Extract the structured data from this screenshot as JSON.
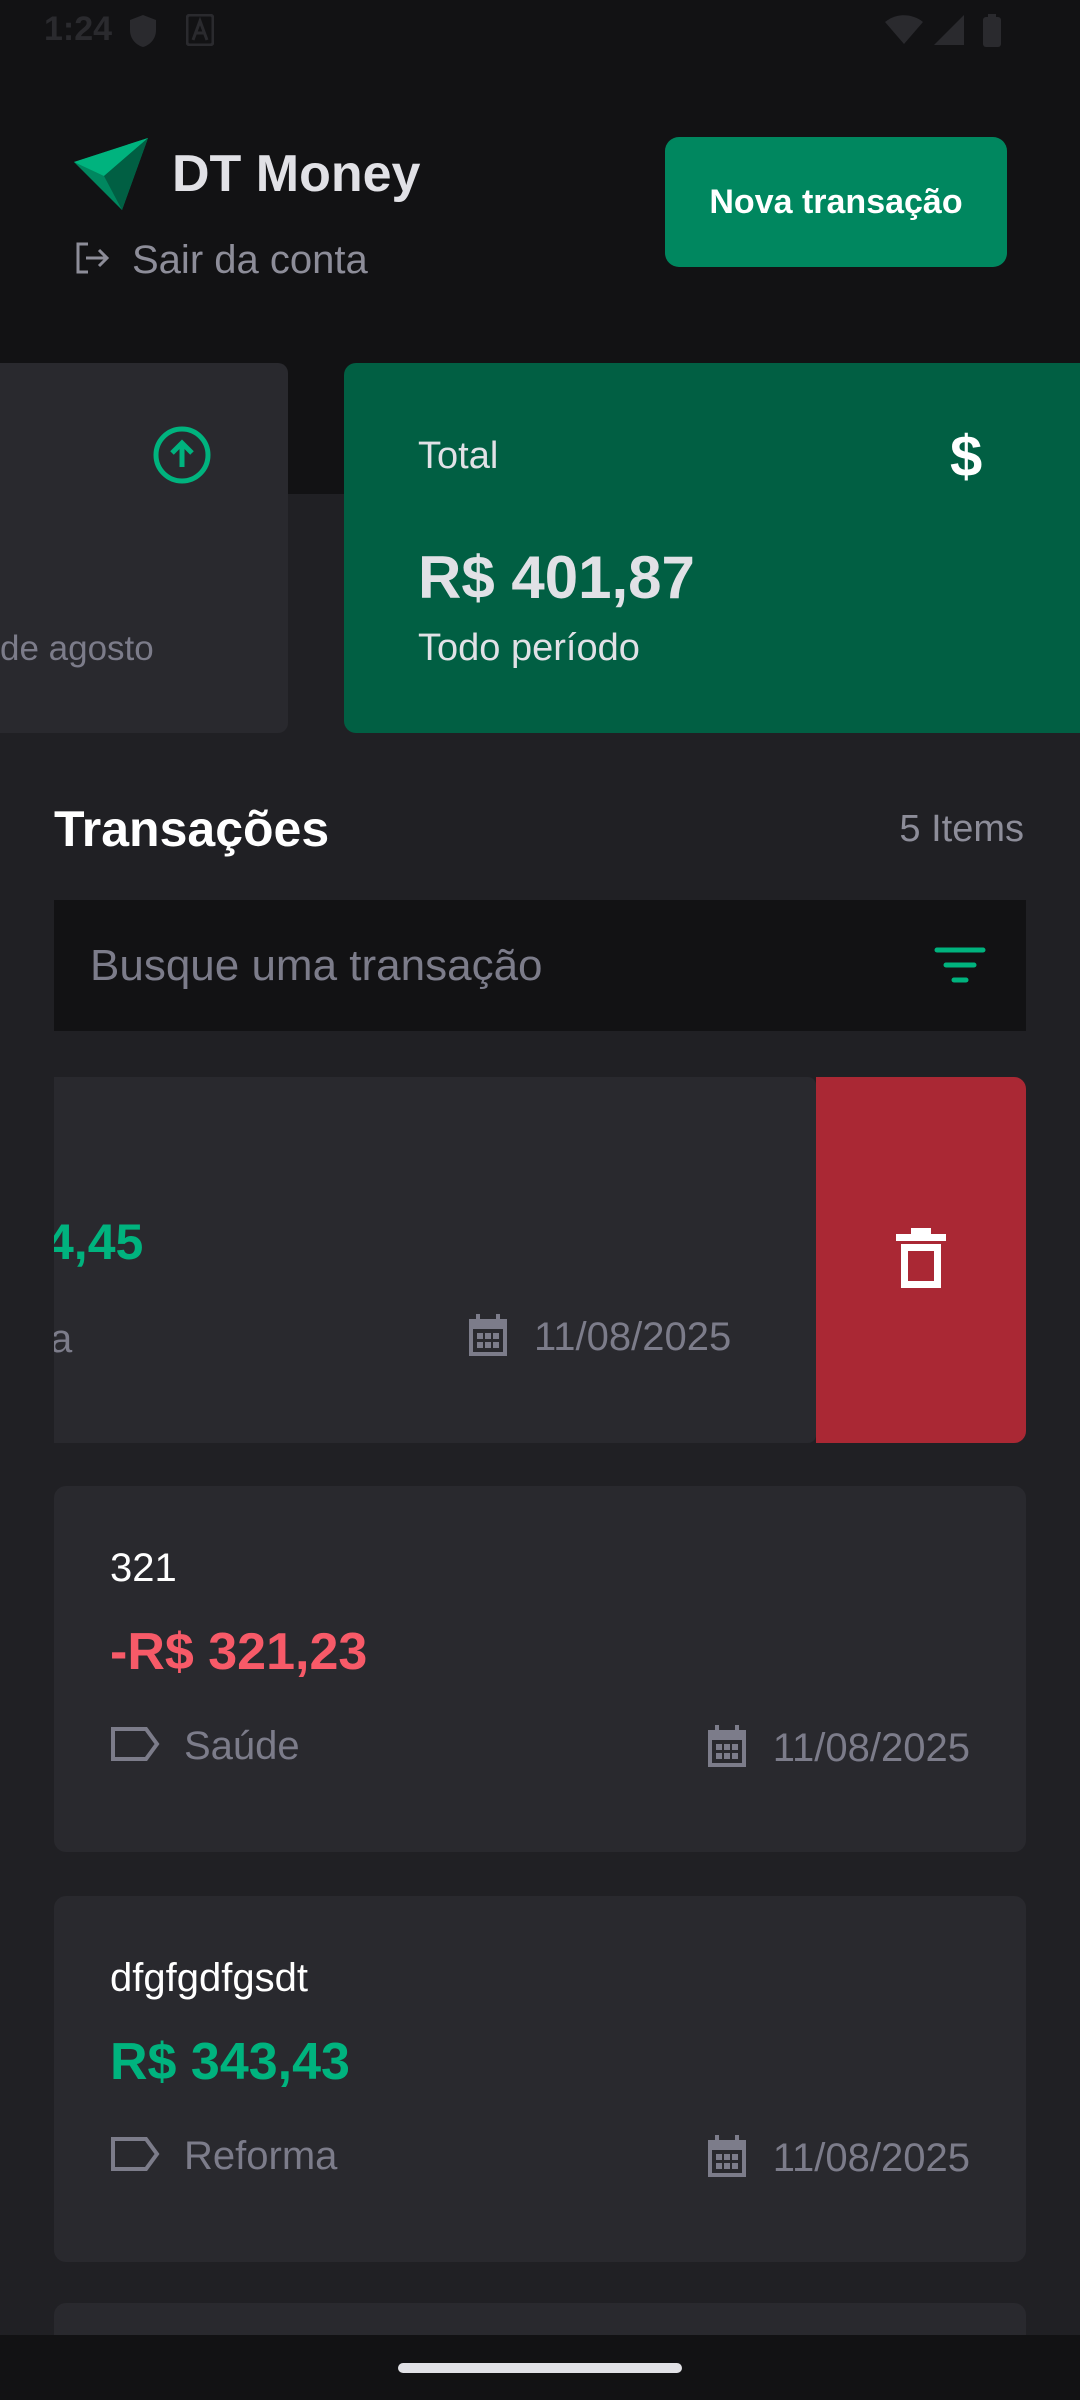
{
  "status_bar": {
    "time": "1:24"
  },
  "header": {
    "app_title": "DT Money",
    "logout_label": "Sair da conta",
    "new_transaction_label": "Nova transação"
  },
  "summary": {
    "partial_card_subtitle": "de agosto",
    "total": {
      "label": "Total",
      "currency_icon": "$",
      "value": "R$ 401,87",
      "period": "Todo período"
    }
  },
  "transactions_section": {
    "title": "Transações",
    "count": "5 Items",
    "search_placeholder": "Busque uma transação"
  },
  "transactions": [
    {
      "amount_partial": "4,45",
      "category_partial": "a",
      "date": "11/08/2025",
      "type": "income",
      "swiped": true
    },
    {
      "description": "321",
      "amount": "-R$ 321,23",
      "category": "Saúde",
      "date": "11/08/2025",
      "type": "expense"
    },
    {
      "description": "dfgfgdfgsdt",
      "amount": "R$ 343,43",
      "category": "Reforma",
      "date": "11/08/2025",
      "type": "income"
    }
  ],
  "colors": {
    "background": "#202024",
    "header_bg": "#121214",
    "card_bg": "#29292e",
    "brand_green": "#00875f",
    "total_card_green": "#015f43",
    "income_green": "#00b37e",
    "expense_red": "#f75a68",
    "delete_red": "#aa2834"
  },
  "icons": [
    "logo-icon",
    "logout-icon",
    "arrow-up-circle-icon",
    "dollar-icon",
    "filter-icon",
    "trash-icon",
    "calendar-icon",
    "tag-icon",
    "shield-icon",
    "a-icon",
    "wifi-icon",
    "signal-icon",
    "battery-icon"
  ]
}
